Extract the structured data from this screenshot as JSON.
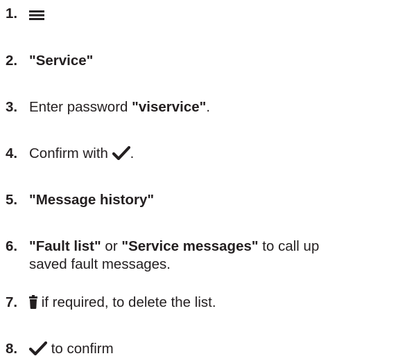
{
  "steps": [
    {
      "number": "1.",
      "icon": "menu-icon"
    },
    {
      "number": "2.",
      "bold": "\"Service\""
    },
    {
      "number": "3.",
      "text": "Enter password ",
      "bold": "\"viservice\"",
      "suffix": "."
    },
    {
      "number": "4.",
      "text": "Confirm with ",
      "icon": "checkmark-icon",
      "suffix": "."
    },
    {
      "number": "5.",
      "bold": "\"Message history\""
    },
    {
      "number": "6.",
      "bold1": "\"Fault list\"",
      "or": " or ",
      "bold2": "\"Service messages\"",
      "line1_suffix": " to call up",
      "line2": "saved fault messages."
    },
    {
      "number": "7.",
      "icon": "trash-icon",
      "text": " if required, to delete the list."
    },
    {
      "number": "8.",
      "icon": "checkmark-icon",
      "text": " to confirm"
    }
  ],
  "colors": {
    "text": "#231f20"
  }
}
